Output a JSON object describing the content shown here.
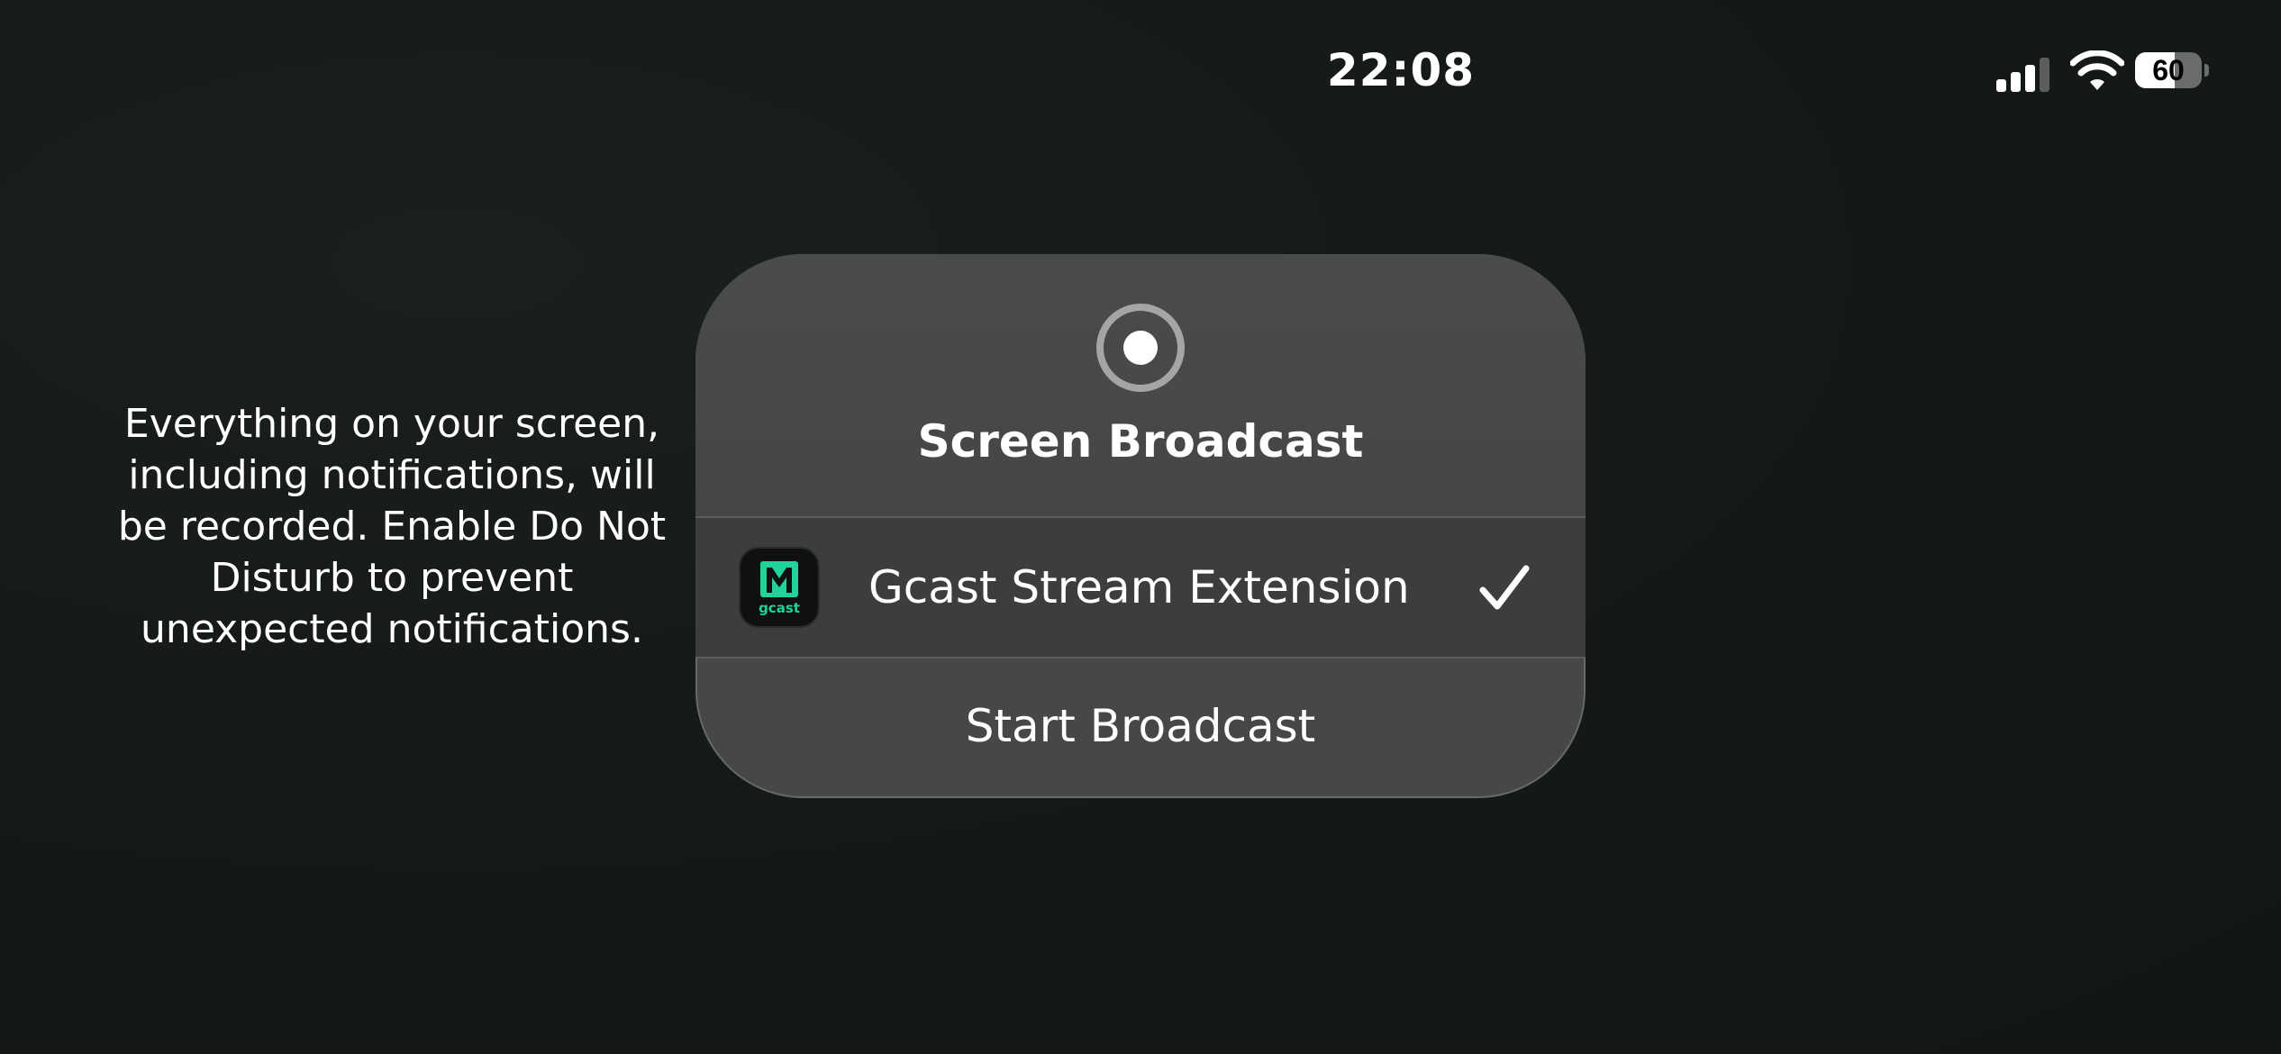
{
  "status_bar": {
    "time": "22:08",
    "battery_percent": "60",
    "battery_level": 0.6,
    "signal_bars_active": 3,
    "signal_bars_total": 4
  },
  "info_text": {
    "lines": [
      "Everything on your screen,",
      "including notifications, will",
      "be recorded. Enable Do Not",
      "Disturb to prevent",
      "unexpected notifications."
    ]
  },
  "dialog": {
    "title": "Screen Broadcast",
    "extension": {
      "name": "Gcast Stream Extension",
      "app_icon_label": "gcast",
      "selected": true,
      "brand_color": "#1fd39a"
    },
    "start_button_label": "Start Broadcast"
  },
  "icons": {
    "record": "record-icon",
    "check": "checkmark-icon",
    "signal": "cellular-signal-icon",
    "wifi": "wifi-icon",
    "battery": "battery-icon",
    "app": "gcast-app-icon"
  }
}
